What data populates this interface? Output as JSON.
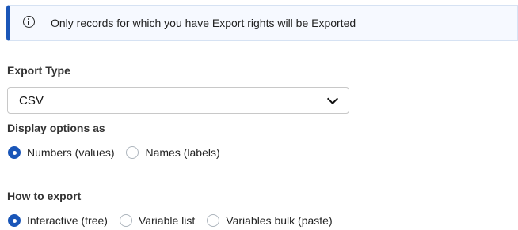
{
  "notice": {
    "icon": "info-circle-icon",
    "text": "Only records for which you have Export rights will be Exported"
  },
  "export_type": {
    "label": "Export Type",
    "selected": "CSV"
  },
  "display_options": {
    "label": "Display options as",
    "options": [
      {
        "label": "Numbers (values)",
        "checked": true
      },
      {
        "label": "Names (labels)",
        "checked": false
      }
    ]
  },
  "how_to_export": {
    "label": "How to export",
    "options": [
      {
        "label": "Interactive (tree)",
        "checked": true
      },
      {
        "label": "Variable list",
        "checked": false
      },
      {
        "label": "Variables bulk (paste)",
        "checked": false
      }
    ]
  },
  "colors": {
    "accent": "#1a56b8"
  }
}
